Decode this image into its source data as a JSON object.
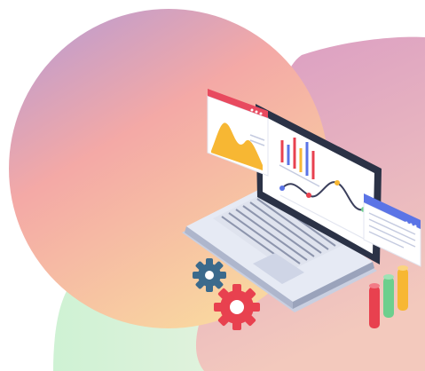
{
  "illustration": {
    "subject": "laptop-analytics",
    "icons": [
      "chart-window-icon",
      "bar-chart-icon",
      "line-chart-icon",
      "text-window-icon",
      "gear-icon",
      "column-bars-icon"
    ]
  },
  "colors": {
    "blob_left_top": "#b49ad6",
    "blob_left_mid": "#f4a9a6",
    "blob_left_bottom": "#f9d6a0",
    "blob_right_top": "#d99ac3",
    "blob_right_bottom": "#f3c9bd",
    "blob_bottom": "#c9f0cf",
    "laptop_body": "#e4e8f3",
    "laptop_dark": "#2b3246",
    "screen": "#ffffff",
    "window_red_header": "#e84a5f",
    "window_blue_header": "#5b74e6",
    "chart_yellow": "#f7b733",
    "gear_blue": "#3b6a8c",
    "gear_red": "#e8414f",
    "bar_red": "#e8414f",
    "bar_green": "#6ccf8d",
    "bar_yellow": "#f7b733"
  }
}
